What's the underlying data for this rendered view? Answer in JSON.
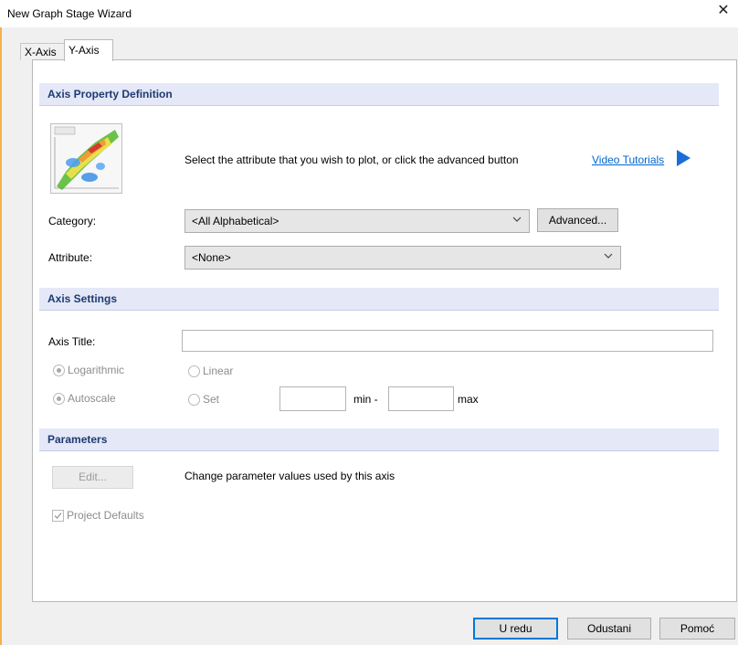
{
  "window": {
    "title": "New Graph Stage Wizard"
  },
  "tabs": [
    {
      "label": "X-Axis"
    },
    {
      "label": "Y-Axis"
    }
  ],
  "axis_property": {
    "header": "Axis Property Definition",
    "instruction": "Select the attribute that you wish to plot, or click the advanced button",
    "video_link": "Video Tutorials",
    "category_label": "Category:",
    "category_value": "<All Alphabetical>",
    "advanced_label": "Advanced...",
    "attribute_label": "Attribute:",
    "attribute_value": "<None>"
  },
  "axis_settings": {
    "header": "Axis Settings",
    "axis_title_label": "Axis Title:",
    "axis_title_value": "",
    "logarithmic_label": "Logarithmic",
    "linear_label": "Linear",
    "autoscale_label": "Autoscale",
    "set_label": "Set",
    "min_label": "min -",
    "max_label": "max",
    "min_value": "",
    "max_value": ""
  },
  "parameters": {
    "header": "Parameters",
    "edit_label": "Edit...",
    "description": "Change parameter values used by this axis",
    "project_defaults_label": "Project Defaults"
  },
  "footer": {
    "ok_label": "U redu",
    "cancel_label": "Odustani",
    "help_label": "Pomoć"
  },
  "colors": {
    "section_header_bg": "#e4e8f7",
    "section_header_text": "#1f3a72",
    "link": "#0066cc",
    "accent": "#0078d7"
  }
}
